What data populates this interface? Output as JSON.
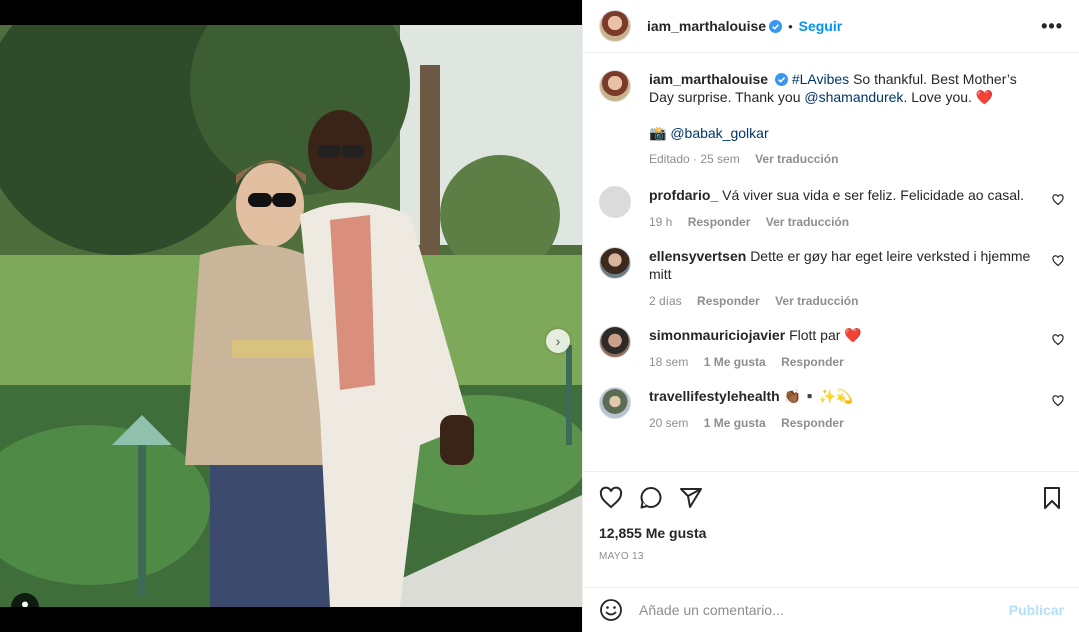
{
  "post": {
    "author": "iam_marthalouise",
    "follow_label": "Seguir",
    "bullet": "•",
    "more_label": "•••"
  },
  "caption": {
    "author": "iam_marthalouise",
    "hashtag": "#LAvibes",
    "text_1": " So thankful. Best Mother’s Day surprise. Thank you ",
    "mention": "@shamandurek",
    "text_2": ". Love you. ❤️",
    "credit_emoji": "📸",
    "credit": "@babak_golkar",
    "edited": "Editado · 25 sem",
    "translate": "Ver traducción"
  },
  "comments": [
    {
      "user": "profdario_",
      "text": "Vá viver sua vida e ser feliz. Felicidade ao casal.",
      "time": "19 h",
      "likes": "",
      "reply": "Responder",
      "translate": "Ver traducción"
    },
    {
      "user": "ellensyvertsen",
      "text": "Dette er gøy har eget leire verksted i hjemme mitt",
      "time": "2 días",
      "likes": "",
      "reply": "Responder",
      "translate": "Ver traducción"
    },
    {
      "user": "simonmauriciojavier",
      "text": "Flott par ❤️",
      "time": "18 sem",
      "likes": "1 Me gusta",
      "reply": "Responder",
      "translate": ""
    },
    {
      "user": "travellifestylehealth",
      "text": "👏🏾▪️✨💫",
      "time": "20 sem",
      "likes": "1 Me gusta",
      "reply": "Responder",
      "translate": ""
    }
  ],
  "stats": {
    "likes": "12,855 Me gusta",
    "date": "MAYO 13"
  },
  "composer": {
    "placeholder": "Añade un comentario...",
    "publish": "Publicar"
  },
  "carousel": {
    "count": 8,
    "active": 0
  },
  "colors": {
    "accent": "#0095f6",
    "verified": "#3897f0",
    "heart": "#ed4956",
    "muted": "#8e8e8e"
  },
  "icons": [
    "heart-icon",
    "comment-icon",
    "share-icon",
    "bookmark-icon",
    "emoji-icon",
    "verified-icon",
    "more-icon",
    "chevron-right-icon",
    "user-tag-icon"
  ]
}
